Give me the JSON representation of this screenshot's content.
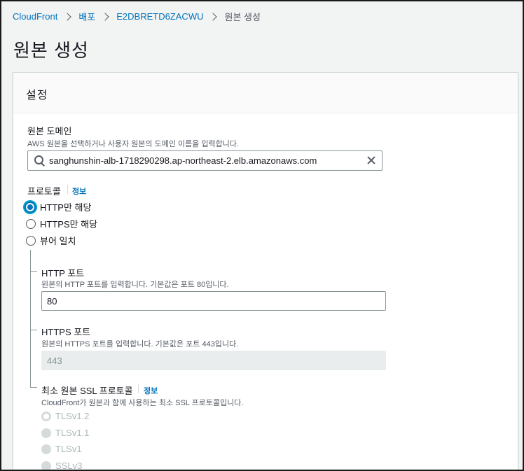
{
  "breadcrumb": {
    "items": [
      "CloudFront",
      "배포",
      "E2DBRETD6ZACWU"
    ],
    "current": "원본 생성"
  },
  "page": {
    "title": "원본 생성"
  },
  "settings": {
    "title": "설정",
    "origin_domain": {
      "label": "원본 도메인",
      "description": "AWS 원본을 선택하거나 사용자 원본의 도메인 이름을 입력합니다.",
      "value": "sanghunshin-alb-1718290298.ap-northeast-2.elb.amazonaws.com"
    },
    "protocol": {
      "label": "프로토콜",
      "info": "정보",
      "options": [
        "HTTP만 해당",
        "HTTPS만 해당",
        "뷰어 일치"
      ],
      "selected": "HTTP만 해당"
    },
    "http_port": {
      "label": "HTTP 포트",
      "description": "원본의 HTTP 포트를 입력합니다. 기본값은 포트 80입니다.",
      "value": "80"
    },
    "https_port": {
      "label": "HTTPS 포트",
      "description": "원본의 HTTPS 포트를 입력합니다. 기본값은 포트 443입니다.",
      "value": "443"
    },
    "min_ssl": {
      "label": "최소 원본 SSL 프로토콜",
      "info": "정보",
      "description": "CloudFront가 원본과 함께 사용하는 최소 SSL 프로토콜입니다.",
      "options": [
        "TLSv1.2",
        "TLSv1.1",
        "TLSv1",
        "SSLv3"
      ],
      "selected": "TLSv1.2"
    }
  },
  "colors": {
    "link": "#0073bb",
    "selected_radio": "#0073bb",
    "disabled": "#aab7b8"
  }
}
